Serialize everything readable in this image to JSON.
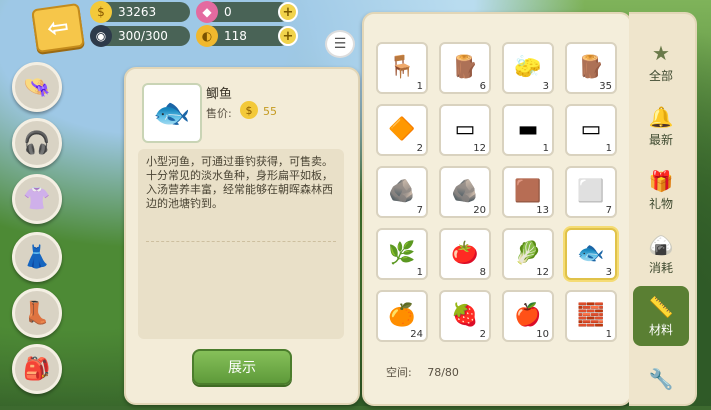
{
  "resources": {
    "coins": "33263",
    "gems": "0",
    "energy": "300/300",
    "tokens": "118"
  },
  "detail": {
    "name": "鲫鱼",
    "price_label": "售价:",
    "price": "55",
    "description": [
      "小型河鱼，可通过垂钓获得，可售卖。",
      "十分常见的淡水鱼种，身形扁平如板，入汤营养丰富，经常能够在朝晖森林西边的池塘钓到。"
    ],
    "show_button": "展示"
  },
  "inventory": {
    "space_label": "空间:",
    "space_value": "78/80",
    "items": [
      {
        "icon": "chair",
        "glyph": "🪑",
        "count": "1",
        "selected": false
      },
      {
        "icon": "birch-log",
        "glyph": "🪵",
        "count": "6",
        "selected": false
      },
      {
        "icon": "sponge",
        "glyph": "🧽",
        "count": "3",
        "selected": false
      },
      {
        "icon": "log",
        "glyph": "🪵",
        "count": "35",
        "selected": false
      },
      {
        "icon": "amber-gem",
        "glyph": "🔶",
        "count": "2",
        "selected": false
      },
      {
        "icon": "marble-plank",
        "glyph": "▭",
        "count": "12",
        "selected": false
      },
      {
        "icon": "wood-plank",
        "glyph": "▬",
        "count": "1",
        "selected": false
      },
      {
        "icon": "stone-beam",
        "glyph": "▭",
        "count": "1",
        "selected": false
      },
      {
        "icon": "gold-ore",
        "glyph": "🪨",
        "count": "7",
        "selected": false
      },
      {
        "icon": "stone",
        "glyph": "🪨",
        "count": "20",
        "selected": false
      },
      {
        "icon": "gold-ingot",
        "glyph": "🟫",
        "count": "13",
        "selected": false
      },
      {
        "icon": "iron-ingot",
        "glyph": "⬜",
        "count": "7",
        "selected": false
      },
      {
        "icon": "herb",
        "glyph": "🌿",
        "count": "1",
        "selected": false
      },
      {
        "icon": "tomato",
        "glyph": "🍅",
        "count": "8",
        "selected": false
      },
      {
        "icon": "radish",
        "glyph": "🥬",
        "count": "12",
        "selected": false
      },
      {
        "icon": "crucian-carp",
        "glyph": "🐟",
        "count": "3",
        "selected": true
      },
      {
        "icon": "orange",
        "glyph": "🍊",
        "count": "24",
        "selected": false
      },
      {
        "icon": "raspberry",
        "glyph": "🍓",
        "count": "2",
        "selected": false
      },
      {
        "icon": "apple",
        "glyph": "🍎",
        "count": "10",
        "selected": false
      },
      {
        "icon": "brick",
        "glyph": "🧱",
        "count": "1",
        "selected": false
      }
    ]
  },
  "tabs": [
    {
      "label": "全部",
      "icon": "star-icon",
      "glyph": "★",
      "active": false
    },
    {
      "label": "最新",
      "icon": "bell-icon",
      "glyph": "🔔",
      "active": false
    },
    {
      "label": "礼物",
      "icon": "gift-icon",
      "glyph": "🎁",
      "active": false
    },
    {
      "label": "消耗",
      "icon": "riceball-icon",
      "glyph": "🍙",
      "active": false
    },
    {
      "label": "材料",
      "icon": "material-icon",
      "glyph": "📏",
      "active": true
    },
    {
      "label": "",
      "icon": "tool-icon",
      "glyph": "🔧",
      "active": false
    }
  ]
}
